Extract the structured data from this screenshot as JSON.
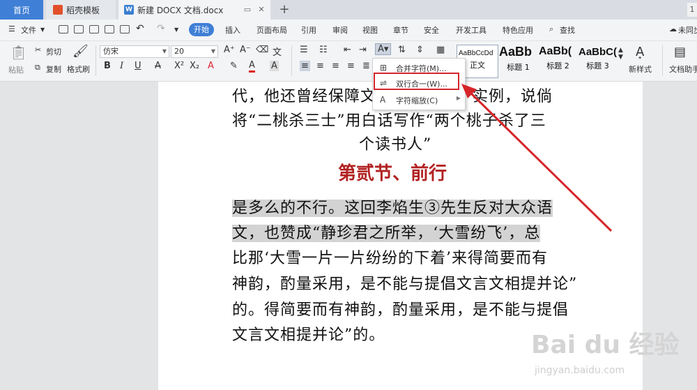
{
  "tabs": {
    "home": "首页",
    "template": "稻壳模板",
    "document": "新建 DOCX 文档.docx",
    "right_badge": "1"
  },
  "menubar": {
    "file": "文件",
    "start": "开始",
    "items": [
      "插入",
      "页面布局",
      "引用",
      "审阅",
      "视图",
      "章节",
      "安全",
      "开发工具",
      "特色应用"
    ],
    "search": "查找",
    "sync": "未同步"
  },
  "ribbon": {
    "paste": "粘贴",
    "cut": "剪切",
    "copy": "复制",
    "format_painter": "格式刷",
    "font_family": "仿宋",
    "font_size": "20",
    "styles": [
      {
        "sample": "AaBbCcDd",
        "label": "正文"
      },
      {
        "sample": "AaBb",
        "label": "标题 1"
      },
      {
        "sample": "AaBb(",
        "label": "标题 2"
      },
      {
        "sample": "AaBbC(",
        "label": "标题 3"
      }
    ],
    "new_style": "新样式",
    "doc_helper": "文档助手"
  },
  "dropdown_menu": {
    "items": [
      {
        "label": "合并字符(M)...",
        "icon": "merge-chars-icon"
      },
      {
        "label": "双行合一(W)...",
        "icon": "two-lines-in-one-icon"
      },
      {
        "label": "字符缩放(C)",
        "icon": "char-scale-icon"
      }
    ]
  },
  "document": {
    "lines_top": [
      "代，他还曾经保障文　　　　一个实例，说倘",
      "将“二桃杀三士”用白话写作“两个桃子杀了三",
      "个读书人”"
    ],
    "heading": "第贰节、前行",
    "lines_body": [
      "是多么的不行。这回李焰生③先生反对大众语",
      "文，也赞成“静珍君之所举，‘大雪纷飞’，总",
      "比那‘大雪一片一片纷纷的下着’来得简要而有",
      "神韵，酌量采用，是不能与提倡文言文相提并论”",
      "的。得简要而有神韵，酌量采用，是不能与提倡",
      "文言文相提并论”的。"
    ]
  },
  "watermark": {
    "brand": "Bai du 经验",
    "url": "jingyan.baidu.com"
  },
  "colors": {
    "accent": "#3f7fd6",
    "heading": "#b22222",
    "annotation": "#d6262a"
  }
}
